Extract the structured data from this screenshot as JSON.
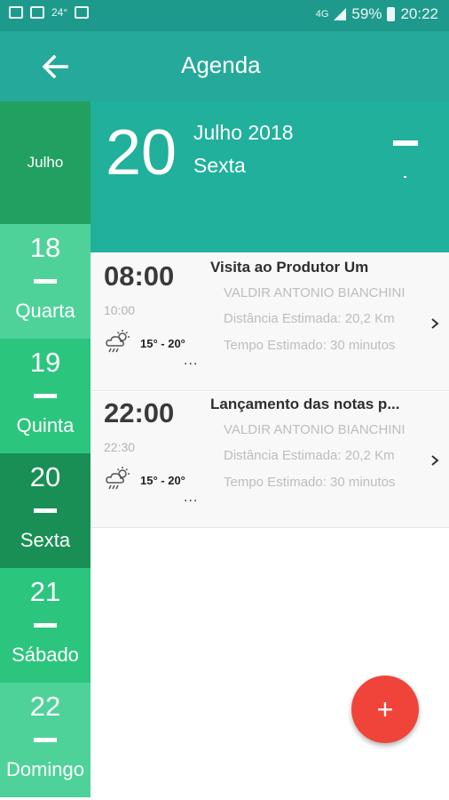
{
  "status_bar": {
    "temperature": "24°",
    "network": "4G",
    "battery": "59%",
    "time": "20:22"
  },
  "app_bar": {
    "title": "Agenda",
    "back_icon": "arrow-left-icon"
  },
  "day_column": {
    "month": "Julho",
    "days": [
      {
        "num": "18",
        "name": "Quarta",
        "bg": "#4fd29a"
      },
      {
        "num": "19",
        "name": "Quinta",
        "bg": "#2cc57e"
      },
      {
        "num": "20",
        "name": "Sexta",
        "bg": "#1a8f55",
        "selected": true
      },
      {
        "num": "21",
        "name": "Sábado",
        "bg": "#2cc57e"
      },
      {
        "num": "22",
        "name": "Domingo",
        "bg": "#4fd29a"
      }
    ]
  },
  "date_header": {
    "day": "20",
    "month_year": "Julho 2018",
    "weekday": "Sexta",
    "bg": "#20b09b"
  },
  "events": [
    {
      "start": "08:00",
      "end": "10:00",
      "temp": "15° - 20°",
      "more": "...",
      "title": "Visita ao Produtor Um",
      "person": "VALDIR ANTONIO BIANCHINI",
      "distance": "Distância Estimada: 20,2 Km",
      "time_est": "Tempo Estimado: 30 minutos"
    },
    {
      "start": "22:00",
      "end": "22:30",
      "temp": "15° - 20°",
      "more": "...",
      "title": "Lançamento das notas p...",
      "person": "VALDIR ANTONIO BIANCHINI",
      "distance": "Distância Estimada: 20,2 Km",
      "time_est": "Tempo Estimado: 30 minutos"
    }
  ],
  "fab": {
    "label": "+",
    "color": "#f0443a"
  }
}
